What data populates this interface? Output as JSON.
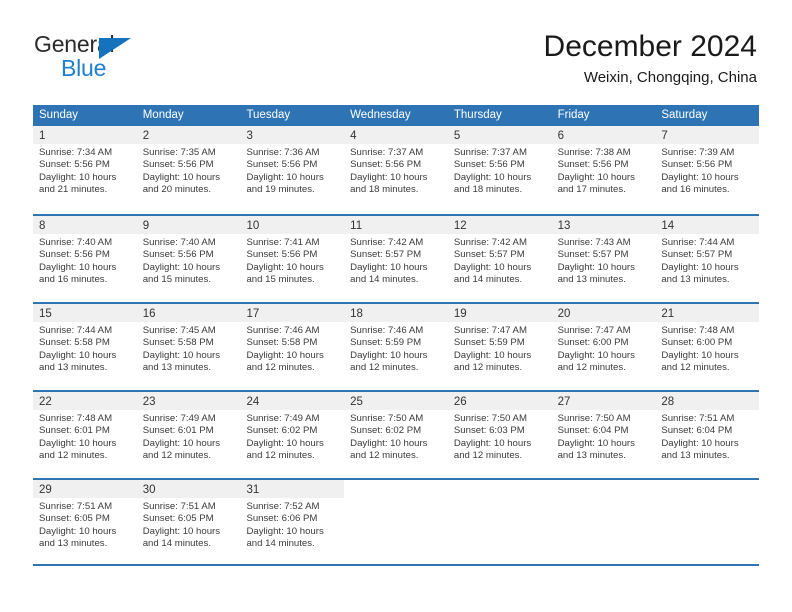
{
  "brand": {
    "name_dark": "General",
    "name_blue": "Blue",
    "triangle_color": "#1573be",
    "blue_color": "#1f7fd0"
  },
  "header": {
    "title": "December 2024",
    "subtitle": "Weixin, Chongqing, China"
  },
  "theme": {
    "header_blue": "#2e74b5",
    "day_band_gray": "#f0f0f0",
    "text_color": "#3b3b3b"
  },
  "weekdays": [
    "Sunday",
    "Monday",
    "Tuesday",
    "Wednesday",
    "Thursday",
    "Friday",
    "Saturday"
  ],
  "weeks": [
    [
      {
        "day": "1",
        "lines": [
          "Sunrise: 7:34 AM",
          "Sunset: 5:56 PM",
          "Daylight: 10 hours",
          "and 21 minutes."
        ]
      },
      {
        "day": "2",
        "lines": [
          "Sunrise: 7:35 AM",
          "Sunset: 5:56 PM",
          "Daylight: 10 hours",
          "and 20 minutes."
        ]
      },
      {
        "day": "3",
        "lines": [
          "Sunrise: 7:36 AM",
          "Sunset: 5:56 PM",
          "Daylight: 10 hours",
          "and 19 minutes."
        ]
      },
      {
        "day": "4",
        "lines": [
          "Sunrise: 7:37 AM",
          "Sunset: 5:56 PM",
          "Daylight: 10 hours",
          "and 18 minutes."
        ]
      },
      {
        "day": "5",
        "lines": [
          "Sunrise: 7:37 AM",
          "Sunset: 5:56 PM",
          "Daylight: 10 hours",
          "and 18 minutes."
        ]
      },
      {
        "day": "6",
        "lines": [
          "Sunrise: 7:38 AM",
          "Sunset: 5:56 PM",
          "Daylight: 10 hours",
          "and 17 minutes."
        ]
      },
      {
        "day": "7",
        "lines": [
          "Sunrise: 7:39 AM",
          "Sunset: 5:56 PM",
          "Daylight: 10 hours",
          "and 16 minutes."
        ]
      }
    ],
    [
      {
        "day": "8",
        "lines": [
          "Sunrise: 7:40 AM",
          "Sunset: 5:56 PM",
          "Daylight: 10 hours",
          "and 16 minutes."
        ]
      },
      {
        "day": "9",
        "lines": [
          "Sunrise: 7:40 AM",
          "Sunset: 5:56 PM",
          "Daylight: 10 hours",
          "and 15 minutes."
        ]
      },
      {
        "day": "10",
        "lines": [
          "Sunrise: 7:41 AM",
          "Sunset: 5:56 PM",
          "Daylight: 10 hours",
          "and 15 minutes."
        ]
      },
      {
        "day": "11",
        "lines": [
          "Sunrise: 7:42 AM",
          "Sunset: 5:57 PM",
          "Daylight: 10 hours",
          "and 14 minutes."
        ]
      },
      {
        "day": "12",
        "lines": [
          "Sunrise: 7:42 AM",
          "Sunset: 5:57 PM",
          "Daylight: 10 hours",
          "and 14 minutes."
        ]
      },
      {
        "day": "13",
        "lines": [
          "Sunrise: 7:43 AM",
          "Sunset: 5:57 PM",
          "Daylight: 10 hours",
          "and 13 minutes."
        ]
      },
      {
        "day": "14",
        "lines": [
          "Sunrise: 7:44 AM",
          "Sunset: 5:57 PM",
          "Daylight: 10 hours",
          "and 13 minutes."
        ]
      }
    ],
    [
      {
        "day": "15",
        "lines": [
          "Sunrise: 7:44 AM",
          "Sunset: 5:58 PM",
          "Daylight: 10 hours",
          "and 13 minutes."
        ]
      },
      {
        "day": "16",
        "lines": [
          "Sunrise: 7:45 AM",
          "Sunset: 5:58 PM",
          "Daylight: 10 hours",
          "and 13 minutes."
        ]
      },
      {
        "day": "17",
        "lines": [
          "Sunrise: 7:46 AM",
          "Sunset: 5:58 PM",
          "Daylight: 10 hours",
          "and 12 minutes."
        ]
      },
      {
        "day": "18",
        "lines": [
          "Sunrise: 7:46 AM",
          "Sunset: 5:59 PM",
          "Daylight: 10 hours",
          "and 12 minutes."
        ]
      },
      {
        "day": "19",
        "lines": [
          "Sunrise: 7:47 AM",
          "Sunset: 5:59 PM",
          "Daylight: 10 hours",
          "and 12 minutes."
        ]
      },
      {
        "day": "20",
        "lines": [
          "Sunrise: 7:47 AM",
          "Sunset: 6:00 PM",
          "Daylight: 10 hours",
          "and 12 minutes."
        ]
      },
      {
        "day": "21",
        "lines": [
          "Sunrise: 7:48 AM",
          "Sunset: 6:00 PM",
          "Daylight: 10 hours",
          "and 12 minutes."
        ]
      }
    ],
    [
      {
        "day": "22",
        "lines": [
          "Sunrise: 7:48 AM",
          "Sunset: 6:01 PM",
          "Daylight: 10 hours",
          "and 12 minutes."
        ]
      },
      {
        "day": "23",
        "lines": [
          "Sunrise: 7:49 AM",
          "Sunset: 6:01 PM",
          "Daylight: 10 hours",
          "and 12 minutes."
        ]
      },
      {
        "day": "24",
        "lines": [
          "Sunrise: 7:49 AM",
          "Sunset: 6:02 PM",
          "Daylight: 10 hours",
          "and 12 minutes."
        ]
      },
      {
        "day": "25",
        "lines": [
          "Sunrise: 7:50 AM",
          "Sunset: 6:02 PM",
          "Daylight: 10 hours",
          "and 12 minutes."
        ]
      },
      {
        "day": "26",
        "lines": [
          "Sunrise: 7:50 AM",
          "Sunset: 6:03 PM",
          "Daylight: 10 hours",
          "and 12 minutes."
        ]
      },
      {
        "day": "27",
        "lines": [
          "Sunrise: 7:50 AM",
          "Sunset: 6:04 PM",
          "Daylight: 10 hours",
          "and 13 minutes."
        ]
      },
      {
        "day": "28",
        "lines": [
          "Sunrise: 7:51 AM",
          "Sunset: 6:04 PM",
          "Daylight: 10 hours",
          "and 13 minutes."
        ]
      }
    ],
    [
      {
        "day": "29",
        "lines": [
          "Sunrise: 7:51 AM",
          "Sunset: 6:05 PM",
          "Daylight: 10 hours",
          "and 13 minutes."
        ]
      },
      {
        "day": "30",
        "lines": [
          "Sunrise: 7:51 AM",
          "Sunset: 6:05 PM",
          "Daylight: 10 hours",
          "and 14 minutes."
        ]
      },
      {
        "day": "31",
        "lines": [
          "Sunrise: 7:52 AM",
          "Sunset: 6:06 PM",
          "Daylight: 10 hours",
          "and 14 minutes."
        ]
      },
      {
        "day": "",
        "lines": []
      },
      {
        "day": "",
        "lines": []
      },
      {
        "day": "",
        "lines": []
      },
      {
        "day": "",
        "lines": []
      }
    ]
  ]
}
